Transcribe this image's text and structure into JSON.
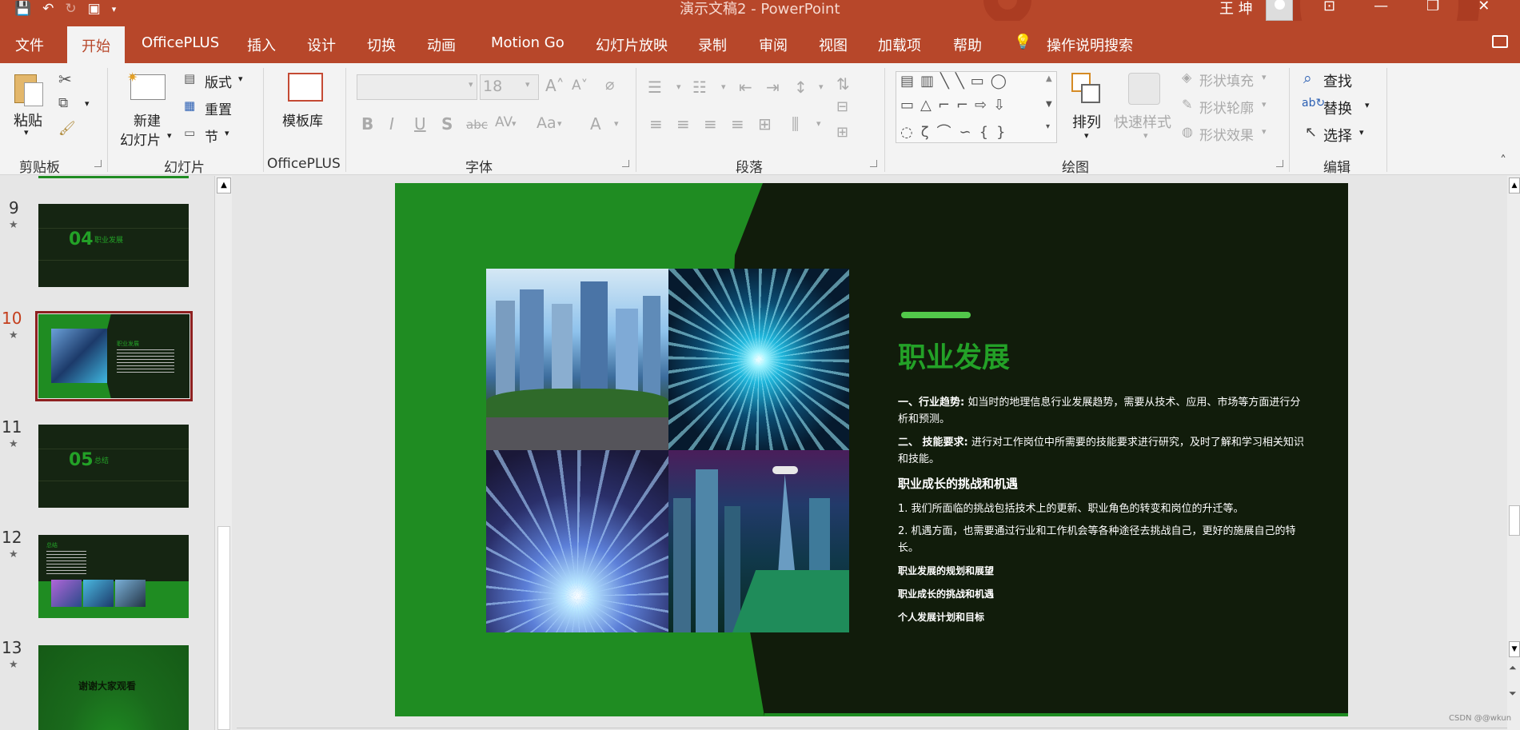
{
  "titlebar": {
    "doc_title": "演示文稿2 - PowerPoint",
    "user_name": "王 坤",
    "qat_icons": [
      "save-icon",
      "undo-icon",
      "redo-icon",
      "present-icon",
      "customize-icon"
    ]
  },
  "menu": {
    "items": [
      "文件",
      "开始",
      "OfficePLUS",
      "插入",
      "设计",
      "切换",
      "动画",
      "Motion Go",
      "幻灯片放映",
      "录制",
      "审阅",
      "视图",
      "加载项",
      "帮助"
    ],
    "active": "开始",
    "tell_me": "操作说明搜索"
  },
  "ribbon": {
    "clipboard": {
      "paste": "粘贴",
      "label": "剪贴板"
    },
    "slides": {
      "new_slide_1": "新建",
      "new_slide_2": "幻灯片",
      "layout": "版式",
      "reset": "重置",
      "section": "节",
      "label": "幻灯片"
    },
    "officeplus": {
      "template": "模板库",
      "label": "OfficePLUS"
    },
    "font": {
      "font_size": "18",
      "bold": "B",
      "italic": "I",
      "underline": "U",
      "shadow": "S",
      "strike": "abc",
      "spacing": "AV",
      "case": "Aa",
      "color": "A",
      "label": "字体"
    },
    "paragraph": {
      "label": "段落"
    },
    "drawing": {
      "arrange": "排列",
      "quick_styles": "快速样式",
      "shape_fill": "形状填充",
      "shape_outline": "形状轮廓",
      "shape_effects": "形状效果",
      "label": "绘图"
    },
    "editing": {
      "find": "查找",
      "replace": "替换",
      "select": "选择",
      "label": "编辑"
    }
  },
  "thumbnails": [
    {
      "num": "9",
      "text": "04",
      "subtitle": "职业发展",
      "selected": false
    },
    {
      "num": "10",
      "text": "职业发展",
      "selected": true
    },
    {
      "num": "11",
      "text": "05",
      "subtitle": "总结",
      "selected": false
    },
    {
      "num": "12",
      "text": "总结",
      "selected": false
    },
    {
      "num": "13",
      "text": "谢谢大家观看",
      "selected": false
    }
  ],
  "slide": {
    "title": "职业发展",
    "p1_bold": "一、行业趋势:",
    "p1_text": " 如当时的地理信息行业发展趋势，需要从技术、应用、市场等方面进行分析和预测。",
    "p2_bold": "二、 技能要求:",
    "p2_text": " 进行对工作岗位中所需要的技能要求进行研究，及时了解和学习相关知识和技能。",
    "heading2": "职业成长的挑战和机遇",
    "item1": "1. 我们所面临的挑战包括技术上的更新、职业角色的转变和岗位的升迁等。",
    "item2": "2. 机遇方面，也需要通过行业和工作机会等各种途径去挑战自己，更好的施展自己的特长。",
    "bold1": "职业发展的规划和展望",
    "bold2": "职业成长的挑战和机遇",
    "bold3": "个人发展计划和目标",
    "colors": {
      "green": "#1f8c22",
      "dark": "#111c0b",
      "title_green": "#23a127",
      "accent": "#52c84a"
    }
  },
  "watermark": "CSDN @@wkun"
}
